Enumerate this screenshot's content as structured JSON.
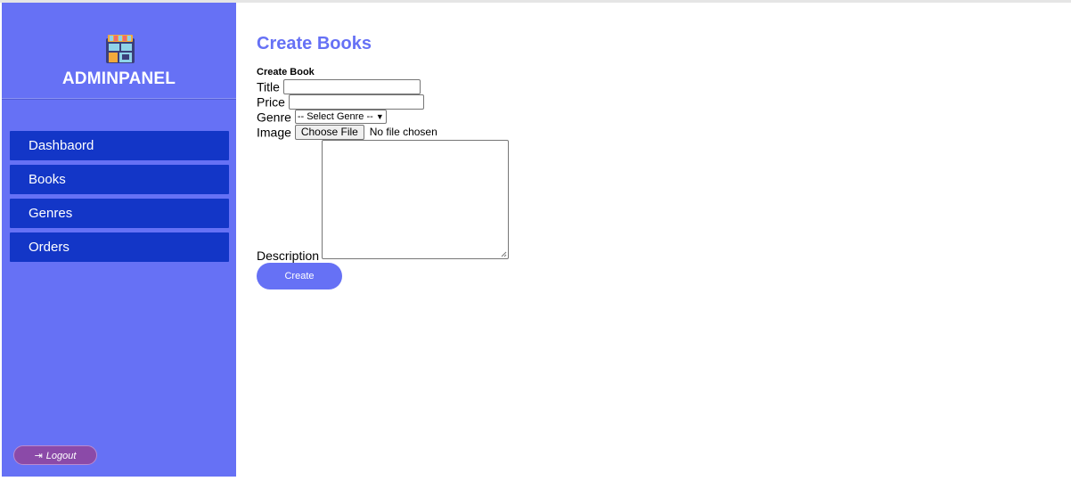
{
  "sidebar": {
    "brand": "ADMINPANEL",
    "logo_icon": "bookstore-icon",
    "items": [
      {
        "label": "Dashbaord"
      },
      {
        "label": "Books"
      },
      {
        "label": "Genres"
      },
      {
        "label": "Orders"
      }
    ],
    "logout_label": "Logout",
    "logout_icon": "sign-out-icon"
  },
  "main": {
    "title": "Create Books",
    "form": {
      "heading": "Create Book",
      "title_label": "Title",
      "title_value": "",
      "price_label": "Price",
      "price_value": "",
      "genre_label": "Genre",
      "genre_selected": "-- Select Genre --",
      "image_label": "Image",
      "file_button": "Choose File",
      "file_status": "No file chosen",
      "description_label": "Description",
      "description_value": "",
      "submit_label": "Create"
    }
  },
  "colors": {
    "sidebar_bg": "#6671f5",
    "nav_item_bg": "#1336c7",
    "accent": "#6671f5",
    "logout_bg": "#8b4aa8"
  }
}
